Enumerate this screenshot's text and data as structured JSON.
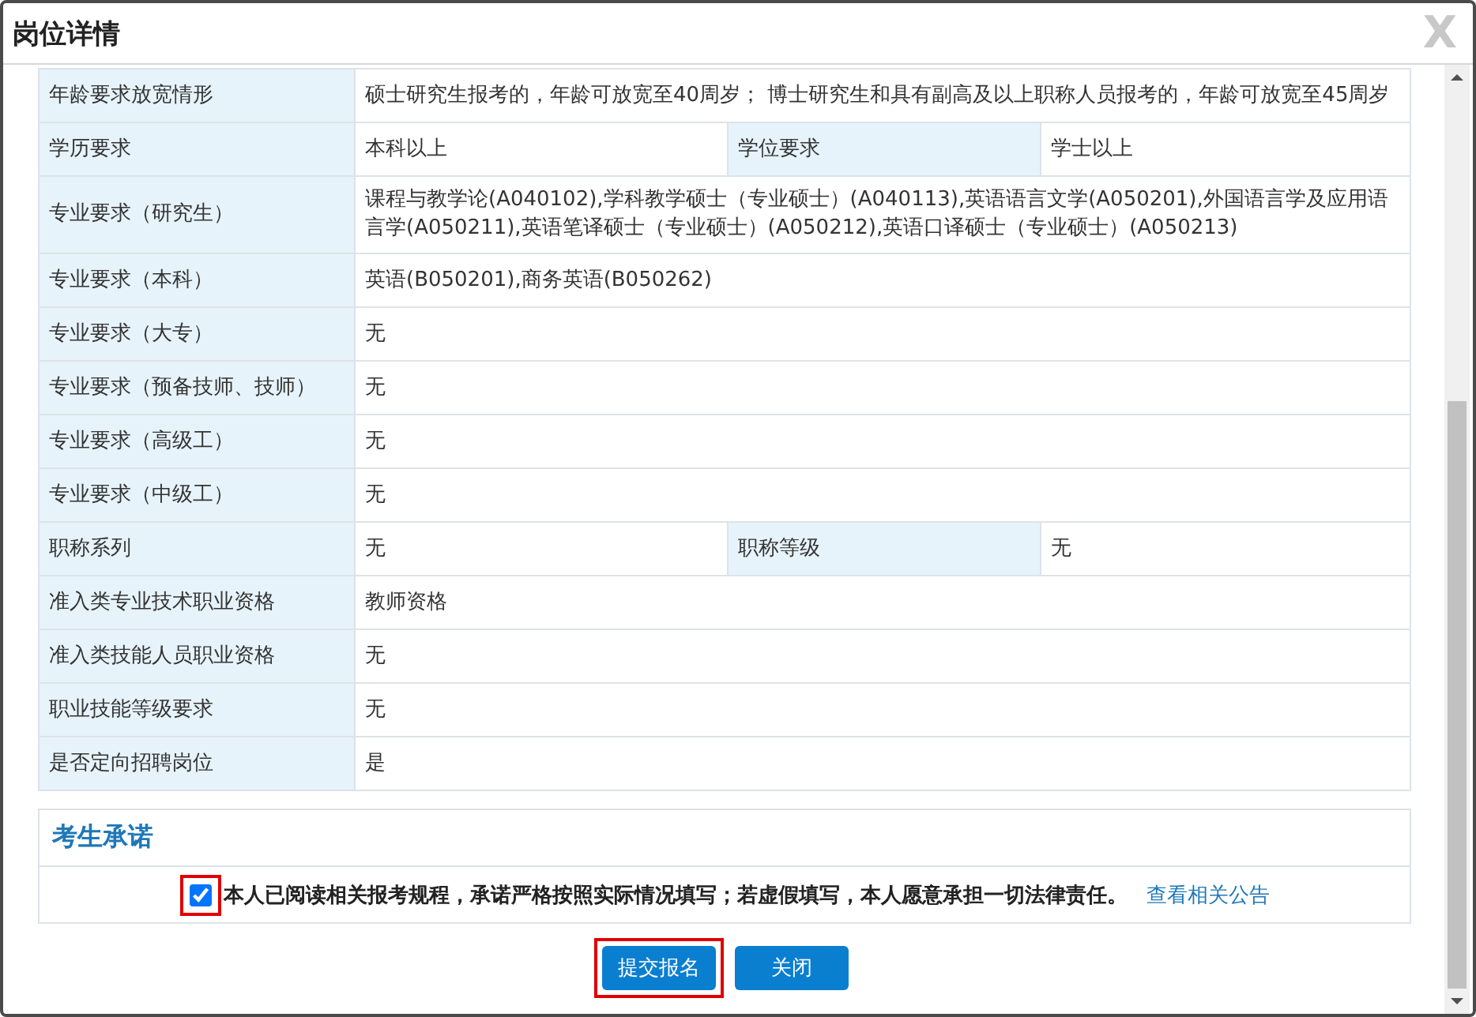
{
  "window": {
    "title": "岗位详情",
    "close": "X"
  },
  "rows": [
    {
      "cells": [
        {
          "label": "年龄要求放宽情形",
          "value": "硕士研究生报考的，年龄可放宽至40周岁；  博士研究生和具有副高及以上职称人员报考的，年龄可放宽至45周岁"
        }
      ]
    },
    {
      "cells": [
        {
          "label": "学历要求",
          "value": "本科以上"
        },
        {
          "label": "学位要求",
          "value": "学士以上"
        }
      ]
    },
    {
      "cells": [
        {
          "label": "专业要求（研究生）",
          "value": "课程与教学论(A040102),学科教学硕士（专业硕士）(A040113),英语语言文学(A050201),外国语言学及应用语言学(A050211),英语笔译硕士（专业硕士）(A050212),英语口译硕士（专业硕士）(A050213)"
        }
      ]
    },
    {
      "cells": [
        {
          "label": "专业要求（本科）",
          "value": "英语(B050201),商务英语(B050262)"
        }
      ]
    },
    {
      "cells": [
        {
          "label": "专业要求（大专）",
          "value": "无"
        }
      ]
    },
    {
      "cells": [
        {
          "label": "专业要求（预备技师、技师）",
          "value": "无"
        }
      ]
    },
    {
      "cells": [
        {
          "label": "专业要求（高级工）",
          "value": "无"
        }
      ]
    },
    {
      "cells": [
        {
          "label": "专业要求（中级工）",
          "value": "无"
        }
      ]
    },
    {
      "cells": [
        {
          "label": "职称系列",
          "value": "无"
        },
        {
          "label": "职称等级",
          "value": "无"
        }
      ]
    },
    {
      "cells": [
        {
          "label": "准入类专业技术职业资格",
          "value": "教师资格"
        }
      ]
    },
    {
      "cells": [
        {
          "label": "准入类技能人员职业资格",
          "value": "无"
        }
      ]
    },
    {
      "cells": [
        {
          "label": "职业技能等级要求",
          "value": "无"
        }
      ]
    },
    {
      "cells": [
        {
          "label": "是否定向招聘岗位",
          "value": "是"
        }
      ]
    }
  ],
  "pledge": {
    "title": "考生承诺",
    "checked": true,
    "highlighted": true,
    "text": "本人已阅读相关报考规程，承诺严格按照实际情况填写；若虚假填写，本人愿意承担一切法律责任。",
    "link": "查看相关公告"
  },
  "buttons": [
    {
      "label": "提交报名",
      "highlighted": true
    },
    {
      "label": "关闭",
      "highlighted": false
    }
  ]
}
